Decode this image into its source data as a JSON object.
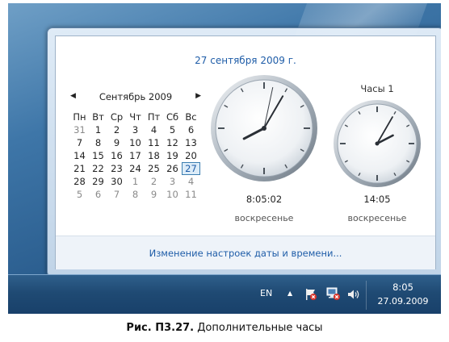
{
  "flyout": {
    "full_date": "27 сентября 2009 г.",
    "calendar": {
      "prev_arrow": "◀",
      "next_arrow": "▶",
      "month_label": "Сентябрь 2009",
      "weekdays": [
        "Пн",
        "Вт",
        "Ср",
        "Чт",
        "Пт",
        "Сб",
        "Вс"
      ],
      "weeks": [
        [
          "31",
          "1",
          "2",
          "3",
          "4",
          "5",
          "6"
        ],
        [
          "7",
          "8",
          "9",
          "10",
          "11",
          "12",
          "13"
        ],
        [
          "14",
          "15",
          "16",
          "17",
          "18",
          "19",
          "20"
        ],
        [
          "21",
          "22",
          "23",
          "24",
          "25",
          "26",
          "27"
        ],
        [
          "28",
          "29",
          "30",
          "1",
          "2",
          "3",
          "4"
        ],
        [
          "5",
          "6",
          "7",
          "8",
          "9",
          "10",
          "11"
        ]
      ],
      "today": "27"
    },
    "clock_main": {
      "time": "8:05:02",
      "day": "воскресенье",
      "hour": 8,
      "minute": 5,
      "second": 2
    },
    "clock_extra": {
      "title": "Часы 1",
      "time": "14:05",
      "day": "воскресенье",
      "hour": 14,
      "minute": 5
    },
    "settings_link": "Изменение настроек даты и времени..."
  },
  "taskbar": {
    "language": "EN",
    "tray_arrow": "▲",
    "icons": [
      "flag-icon",
      "network-icon",
      "volume-icon"
    ],
    "time": "8:05",
    "date": "27.09.2009"
  },
  "caption": {
    "label": "Рис. П3.27.",
    "text": " Дополнительные часы"
  }
}
